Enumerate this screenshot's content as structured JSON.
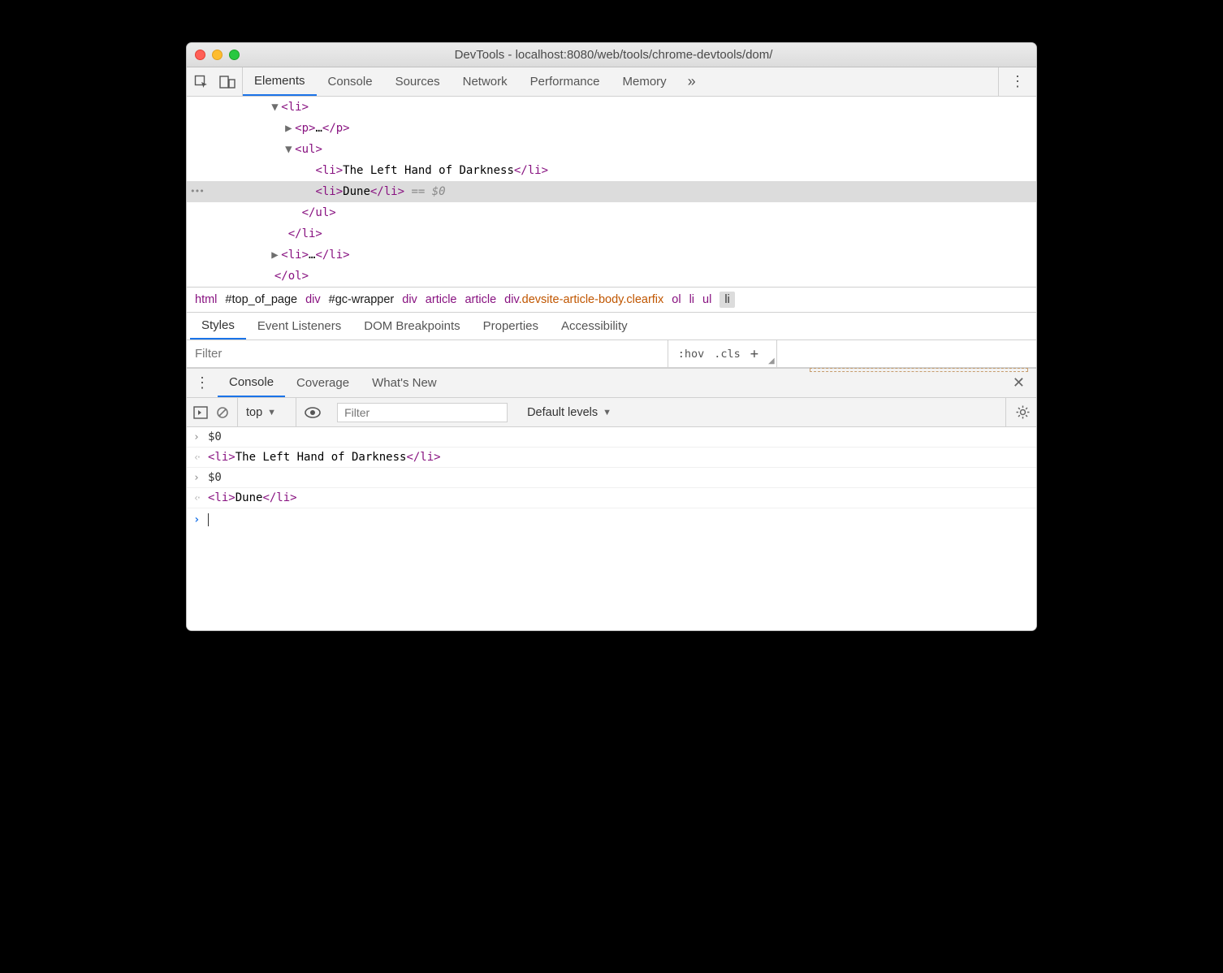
{
  "window_title": "DevTools - localhost:8080/web/tools/chrome-devtools/dom/",
  "main_tabs": [
    "Elements",
    "Console",
    "Sources",
    "Network",
    "Performance",
    "Memory"
  ],
  "main_tab_active": "Elements",
  "dom_tree": {
    "lines": [
      {
        "indent": 10,
        "tri": "▼",
        "open": "<li>",
        "close": ""
      },
      {
        "indent": 12,
        "tri": "▶",
        "open": "<p>",
        "mid": "…",
        "close": "</p>"
      },
      {
        "indent": 12,
        "tri": "▼",
        "open": "<ul>",
        "close": ""
      },
      {
        "indent": 15,
        "tri": "",
        "open": "<li>",
        "mid": "The Left Hand of Darkness",
        "close": "</li>"
      },
      {
        "indent": 15,
        "tri": "",
        "open": "<li>",
        "mid": "Dune",
        "close": "</li>",
        "selected": true,
        "suffix": " == $0"
      },
      {
        "indent": 13,
        "tri": "",
        "open": "</ul>",
        "close": ""
      },
      {
        "indent": 11,
        "tri": "",
        "open": "</li>",
        "close": ""
      },
      {
        "indent": 10,
        "tri": "▶",
        "open": "<li>",
        "mid": "…",
        "close": "</li>"
      },
      {
        "indent": 9,
        "tri": "",
        "open": "</ol>",
        "close": ""
      }
    ]
  },
  "breadcrumb": [
    {
      "t": "html",
      "k": "tag"
    },
    {
      "t": "#top_of_page",
      "k": "id"
    },
    {
      "t": "div",
      "k": "tag"
    },
    {
      "t": "#gc-wrapper",
      "k": "id"
    },
    {
      "t": "div",
      "k": "tag"
    },
    {
      "t": "article",
      "k": "tag"
    },
    {
      "t": "article",
      "k": "tag"
    },
    {
      "t": "div.devsite-article-body.clearfix",
      "k": "mixed"
    },
    {
      "t": "ol",
      "k": "tag"
    },
    {
      "t": "li",
      "k": "tag"
    },
    {
      "t": "ul",
      "k": "tag"
    },
    {
      "t": "li",
      "k": "sel"
    }
  ],
  "styles_tabs": [
    "Styles",
    "Event Listeners",
    "DOM Breakpoints",
    "Properties",
    "Accessibility"
  ],
  "styles_tab_active": "Styles",
  "styles_filter_placeholder": "Filter",
  "styles_pseudo": ":hov",
  "styles_cls": ".cls",
  "drawer_tabs": [
    "Console",
    "Coverage",
    "What's New"
  ],
  "drawer_tab_active": "Console",
  "console_context": "top",
  "console_filter_placeholder": "Filter",
  "console_levels": "Default levels",
  "console_lines": [
    {
      "type": "input",
      "text": "$0"
    },
    {
      "type": "output",
      "html": [
        {
          "tag": "<li>"
        },
        {
          "txt": "The Left Hand of Darkness"
        },
        {
          "tag": "</li>"
        }
      ],
      "indent": true
    },
    {
      "type": "input",
      "text": "$0"
    },
    {
      "type": "output",
      "html": [
        {
          "tag": "<li>"
        },
        {
          "txt": "Dune"
        },
        {
          "tag": "</li>"
        }
      ],
      "indent": true
    }
  ]
}
